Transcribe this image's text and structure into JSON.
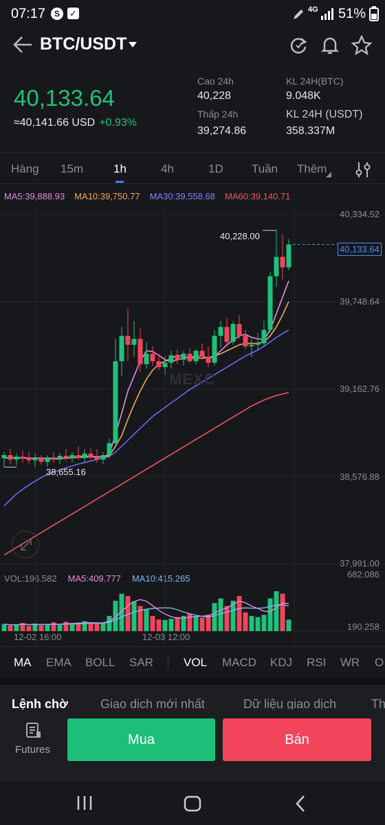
{
  "status": {
    "time": "07:17",
    "network": "4G",
    "battery": "51%"
  },
  "header": {
    "pair": "BTC/USDT"
  },
  "ticker": {
    "last_price": "40,133.64",
    "usd_price": "≈40,141.66 USD",
    "change": "+0.93%",
    "high_label": "Cao 24h",
    "high_value": "40,228",
    "low_label": "Thấp 24h",
    "low_value": "39,274.86",
    "vol_btc_label": "KL 24H(BTC)",
    "vol_btc_value": "9.048K",
    "vol_usdt_label": "KL 24H (USDT)",
    "vol_usdt_value": "358.337M"
  },
  "timeframes": [
    "Hàng",
    "15m",
    "1h",
    "4h",
    "1D",
    "Tuần",
    "Thêm"
  ],
  "active_timeframe": "1h",
  "ma_legend": {
    "ma5": "MA5:39,888.93",
    "ma10": "MA10:39,750.77",
    "ma30": "MA30:39,558.68",
    "ma60": "MA60:39,140.71"
  },
  "price_axis": [
    "40,334.52",
    "39,748.64",
    "39,162.76",
    "38,576.88",
    "37,991.00"
  ],
  "chart_labels": {
    "high_marker": "40,228.00",
    "low_marker": "38,655.16",
    "current_price_tag": "40,133.64",
    "watermark": "MEXC"
  },
  "volume_legend": {
    "vol": "VOL:196.582",
    "ma5": "MA5:409.777",
    "ma10": "MA10:415.265"
  },
  "volume_axis": [
    "682.086",
    "190.258"
  ],
  "time_axis": [
    "12-02 16:00",
    "12-03 12:00"
  ],
  "indicators_main": [
    "MA",
    "EMA",
    "BOLL",
    "SAR"
  ],
  "indicators_sub": [
    "VOL",
    "MACD",
    "KDJ",
    "RSI",
    "WR",
    "O"
  ],
  "book_tabs": [
    "Lệnh chờ",
    "Giao dịch mới nhất",
    "Dữ liệu giao dịch",
    "Th"
  ],
  "bottom": {
    "futures": "Futures",
    "buy": "Mua",
    "sell": "Bán"
  },
  "colors": {
    "up": "#1fc17b",
    "down": "#f2455c",
    "ma5": "#e58be0",
    "ma10": "#f0a85a",
    "ma30": "#6f67f5",
    "ma60": "#f0555a"
  },
  "chart_data": {
    "type": "candlestick",
    "ylim": [
      37991.0,
      40334.52
    ],
    "candles": [
      {
        "o": 38700,
        "h": 38740,
        "l": 38640,
        "c": 38720
      },
      {
        "o": 38720,
        "h": 38760,
        "l": 38660,
        "c": 38690
      },
      {
        "o": 38690,
        "h": 38730,
        "l": 38650,
        "c": 38710
      },
      {
        "o": 38710,
        "h": 38750,
        "l": 38670,
        "c": 38700
      },
      {
        "o": 38700,
        "h": 38740,
        "l": 38660,
        "c": 38685
      },
      {
        "o": 38685,
        "h": 38730,
        "l": 38640,
        "c": 38700
      },
      {
        "o": 38700,
        "h": 38720,
        "l": 38655,
        "c": 38675
      },
      {
        "o": 38675,
        "h": 38720,
        "l": 38640,
        "c": 38705
      },
      {
        "o": 38705,
        "h": 38740,
        "l": 38670,
        "c": 38690
      },
      {
        "o": 38690,
        "h": 38735,
        "l": 38660,
        "c": 38715
      },
      {
        "o": 38715,
        "h": 38760,
        "l": 38680,
        "c": 38700
      },
      {
        "o": 38700,
        "h": 38740,
        "l": 38670,
        "c": 38720
      },
      {
        "o": 38720,
        "h": 38780,
        "l": 38690,
        "c": 38700
      },
      {
        "o": 38700,
        "h": 38760,
        "l": 38670,
        "c": 38730
      },
      {
        "o": 38730,
        "h": 38770,
        "l": 38690,
        "c": 38705
      },
      {
        "o": 38705,
        "h": 38760,
        "l": 38670,
        "c": 38690
      },
      {
        "o": 38690,
        "h": 38740,
        "l": 38660,
        "c": 38720
      },
      {
        "o": 38720,
        "h": 38830,
        "l": 38700,
        "c": 38800
      },
      {
        "o": 38800,
        "h": 39500,
        "l": 38790,
        "c": 39350
      },
      {
        "o": 39350,
        "h": 39580,
        "l": 39250,
        "c": 39520
      },
      {
        "o": 39520,
        "h": 39700,
        "l": 39350,
        "c": 39460
      },
      {
        "o": 39460,
        "h": 39620,
        "l": 39380,
        "c": 39500
      },
      {
        "o": 39500,
        "h": 39570,
        "l": 39280,
        "c": 39330
      },
      {
        "o": 39330,
        "h": 39480,
        "l": 39300,
        "c": 39400
      },
      {
        "o": 39400,
        "h": 39450,
        "l": 39320,
        "c": 39350
      },
      {
        "o": 39350,
        "h": 39400,
        "l": 39290,
        "c": 39310
      },
      {
        "o": 39310,
        "h": 39380,
        "l": 39260,
        "c": 39340
      },
      {
        "o": 39340,
        "h": 39420,
        "l": 39300,
        "c": 39390
      },
      {
        "o": 39390,
        "h": 39430,
        "l": 39330,
        "c": 39360
      },
      {
        "o": 39360,
        "h": 39420,
        "l": 39320,
        "c": 39400
      },
      {
        "o": 39400,
        "h": 39440,
        "l": 39340,
        "c": 39350
      },
      {
        "o": 39350,
        "h": 39430,
        "l": 39330,
        "c": 39420
      },
      {
        "o": 39420,
        "h": 39470,
        "l": 39360,
        "c": 39380
      },
      {
        "o": 39380,
        "h": 39450,
        "l": 39310,
        "c": 39340
      },
      {
        "o": 39340,
        "h": 39560,
        "l": 39320,
        "c": 39520
      },
      {
        "o": 39520,
        "h": 39620,
        "l": 39440,
        "c": 39580
      },
      {
        "o": 39580,
        "h": 39640,
        "l": 39450,
        "c": 39480
      },
      {
        "o": 39480,
        "h": 39620,
        "l": 39460,
        "c": 39600
      },
      {
        "o": 39600,
        "h": 39660,
        "l": 39500,
        "c": 39520
      },
      {
        "o": 39520,
        "h": 39560,
        "l": 39430,
        "c": 39450
      },
      {
        "o": 39450,
        "h": 39500,
        "l": 39380,
        "c": 39460
      },
      {
        "o": 39460,
        "h": 39540,
        "l": 39420,
        "c": 39470
      },
      {
        "o": 39470,
        "h": 39620,
        "l": 39450,
        "c": 39560
      },
      {
        "o": 39560,
        "h": 39950,
        "l": 39540,
        "c": 39920
      },
      {
        "o": 39920,
        "h": 40228,
        "l": 39850,
        "c": 40050
      },
      {
        "o": 40050,
        "h": 40200,
        "l": 39900,
        "c": 39980
      },
      {
        "o": 39980,
        "h": 40170,
        "l": 39960,
        "c": 40133.64
      }
    ],
    "ma_series": {
      "ma5": [
        38700,
        38705,
        38700,
        38702,
        38700,
        38700,
        38700,
        38696,
        38694,
        38695,
        38702,
        38706,
        38710,
        38712,
        38712,
        38709,
        38709,
        38725,
        38860,
        39000,
        39150,
        39250,
        39350,
        39420,
        39415,
        39390,
        39360,
        39345,
        39360,
        39370,
        39380,
        39380,
        39385,
        39370,
        39380,
        39420,
        39460,
        39490,
        39520,
        39530,
        39510,
        39500,
        39495,
        39560,
        39670,
        39780,
        39889
      ],
      "ma10": [
        38700,
        38702,
        38702,
        38701,
        38700,
        38700,
        38699,
        38698,
        38697,
        38697,
        38700,
        38702,
        38704,
        38706,
        38708,
        38709,
        38710,
        38715,
        38780,
        38850,
        38960,
        39060,
        39150,
        39230,
        39290,
        39330,
        39350,
        39370,
        39390,
        39380,
        39370,
        39370,
        39370,
        39375,
        39385,
        39400,
        39420,
        39440,
        39460,
        39470,
        39470,
        39470,
        39480,
        39520,
        39580,
        39660,
        39751
      ],
      "ma30": [
        38380,
        38420,
        38460,
        38490,
        38520,
        38545,
        38570,
        38590,
        38605,
        38620,
        38635,
        38648,
        38660,
        38670,
        38680,
        38690,
        38700,
        38712,
        38740,
        38780,
        38820,
        38860,
        38900,
        38940,
        38980,
        39010,
        39040,
        39070,
        39100,
        39130,
        39160,
        39185,
        39210,
        39235,
        39260,
        39285,
        39310,
        39335,
        39360,
        39385,
        39405,
        39425,
        39450,
        39480,
        39510,
        39535,
        39559
      ],
      "ma60": [
        38050,
        38075,
        38100,
        38125,
        38150,
        38175,
        38200,
        38225,
        38250,
        38275,
        38300,
        38325,
        38350,
        38375,
        38400,
        38425,
        38450,
        38475,
        38500,
        38525,
        38550,
        38575,
        38600,
        38625,
        38650,
        38675,
        38700,
        38725,
        38750,
        38775,
        38800,
        38825,
        38850,
        38875,
        38900,
        38925,
        38950,
        38975,
        39000,
        39025,
        39050,
        39070,
        39090,
        39105,
        39120,
        39130,
        39141
      ]
    },
    "volume_ylim": [
      0,
      682.086
    ],
    "volumes": [
      120,
      95,
      110,
      140,
      90,
      130,
      100,
      115,
      150,
      105,
      160,
      130,
      140,
      170,
      125,
      135,
      145,
      260,
      520,
      640,
      600,
      510,
      430,
      380,
      260,
      200,
      190,
      210,
      240,
      260,
      300,
      250,
      230,
      280,
      480,
      560,
      430,
      520,
      600,
      320,
      260,
      240,
      280,
      560,
      682,
      640,
      196.582
    ]
  }
}
